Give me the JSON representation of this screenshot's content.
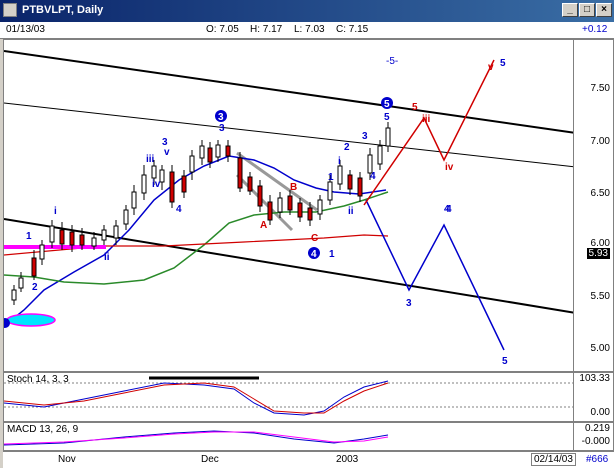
{
  "window": {
    "title": "PTBVLPT, Daily"
  },
  "infobar": {
    "date": "01/13/03",
    "open": "O: 7.05",
    "high": "H: 7.17",
    "low": "L: 7.03",
    "close": "C: 7.15",
    "change": "+0.12"
  },
  "price_axis": {
    "labels": [
      "7.50",
      "7.00",
      "6.50",
      "6.00",
      "5.93",
      "5.50",
      "5.00"
    ],
    "current": "5.93"
  },
  "stoch": {
    "label": "Stoch 14, 3, 3",
    "axis": [
      "103.33",
      "0.00"
    ]
  },
  "macd": {
    "label": "MACD 13, 26, 9",
    "axis": [
      "0.219",
      "-0.000"
    ]
  },
  "time_axis": {
    "labels": [
      "Nov",
      "Dec",
      "2003"
    ],
    "end_date": "02/14/03",
    "counter": "#666"
  },
  "annotations": {
    "wave_labels_blue": [
      "1",
      "2",
      "3",
      "iii",
      "iv",
      "v",
      "4",
      "3",
      "ii",
      "i",
      "1",
      "2",
      "3",
      "4",
      "5",
      "i",
      "ii",
      "4",
      "5",
      "3",
      "4",
      "5",
      "-5-",
      "1"
    ],
    "wave_labels_red": [
      "A",
      "B",
      "C",
      "iii",
      "iv",
      "v",
      "5"
    ],
    "circled": [
      "3",
      "4",
      "5"
    ]
  },
  "colors": {
    "blue": "#0000cc",
    "red": "#d00000",
    "green": "#2a8a2a",
    "magenta": "#ff00ff",
    "cyan": "#00e5ff"
  }
}
